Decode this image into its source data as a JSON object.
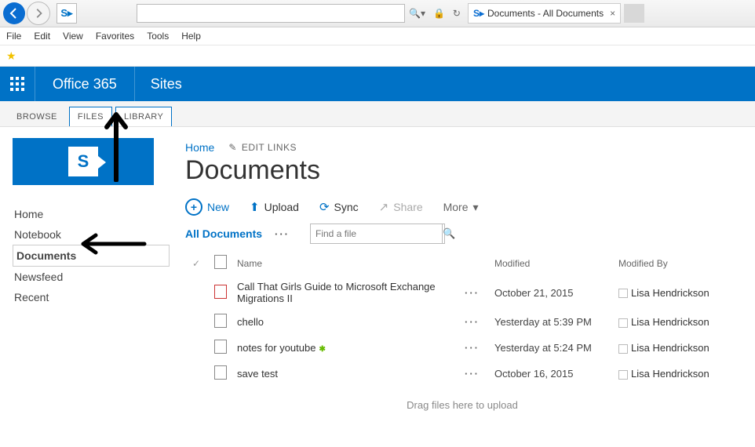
{
  "ie": {
    "tab_title": "Documents - All Documents",
    "menu": [
      "File",
      "Edit",
      "View",
      "Favorites",
      "Tools",
      "Help"
    ]
  },
  "suite": {
    "brand": "Office 365",
    "sites": "Sites"
  },
  "ribbon": {
    "browse": "BROWSE",
    "files": "FILES",
    "library": "LIBRARY"
  },
  "nav": {
    "items": [
      "Home",
      "Notebook",
      "Documents",
      "Newsfeed",
      "Recent"
    ],
    "selected_index": 2
  },
  "breadcrumb": {
    "home": "Home",
    "edit_links": "EDIT LINKS"
  },
  "page_title": "Documents",
  "toolbar": {
    "new": "New",
    "upload": "Upload",
    "sync": "Sync",
    "share": "Share",
    "more": "More"
  },
  "view": {
    "name": "All Documents",
    "find_placeholder": "Find a file"
  },
  "columns": {
    "name": "Name",
    "modified": "Modified",
    "by": "Modified By"
  },
  "rows": [
    {
      "icon": "pdf",
      "title": "Call That Girls Guide to Microsoft Exchange Migrations II",
      "new": false,
      "modified": "October 21, 2015",
      "by": "Lisa Hendrickson"
    },
    {
      "icon": "note",
      "title": "chello",
      "new": false,
      "modified": "Yesterday at 5:39 PM",
      "by": "Lisa Hendrickson"
    },
    {
      "icon": "note",
      "title": "notes for youtube",
      "new": true,
      "modified": "Yesterday at 5:24 PM",
      "by": "Lisa Hendrickson"
    },
    {
      "icon": "note",
      "title": "save test",
      "new": false,
      "modified": "October 16, 2015",
      "by": "Lisa Hendrickson"
    }
  ],
  "dragmsg": "Drag files here to upload"
}
